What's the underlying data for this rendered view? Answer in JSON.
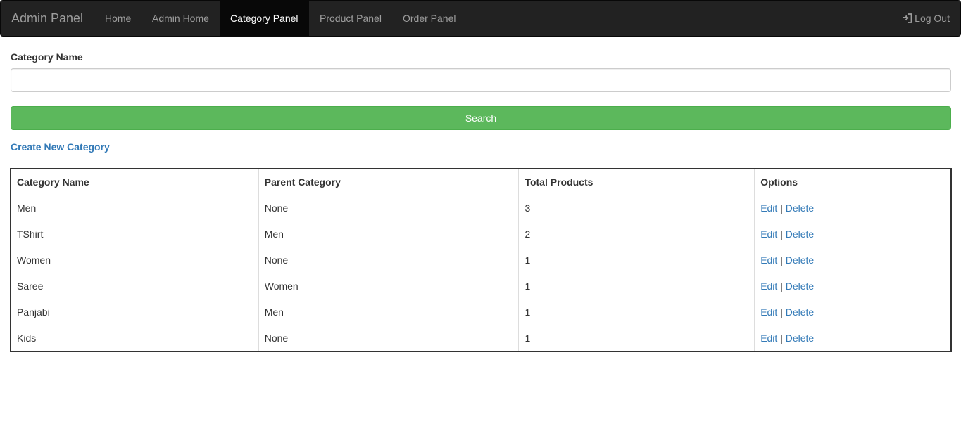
{
  "navbar": {
    "brand": "Admin Panel",
    "items": [
      {
        "label": "Home"
      },
      {
        "label": "Admin Home"
      },
      {
        "label": "Category Panel"
      },
      {
        "label": "Product Panel"
      },
      {
        "label": "Order Panel"
      }
    ],
    "logout": "Log Out"
  },
  "form": {
    "label": "Category Name",
    "value": "",
    "button": "Search"
  },
  "create_link": "Create New Category",
  "table": {
    "headers": [
      "Category Name",
      "Parent Category",
      "Total Products",
      "Options"
    ],
    "rows": [
      {
        "name": "Men",
        "parent": "None",
        "total": "3",
        "edit": "Edit",
        "sep": "|",
        "delete": "Delete"
      },
      {
        "name": "TShirt",
        "parent": "Men",
        "total": "2",
        "edit": "Edit",
        "sep": "|",
        "delete": "Delete"
      },
      {
        "name": "Women",
        "parent": "None",
        "total": "1",
        "edit": "Edit",
        "sep": "|",
        "delete": "Delete"
      },
      {
        "name": "Saree",
        "parent": "Women",
        "total": "1",
        "edit": "Edit",
        "sep": "|",
        "delete": "Delete"
      },
      {
        "name": "Panjabi",
        "parent": "Men",
        "total": "1",
        "edit": "Edit",
        "sep": "|",
        "delete": "Delete"
      },
      {
        "name": "Kids",
        "parent": "None",
        "total": "1",
        "edit": "Edit",
        "sep": "|",
        "delete": "Delete"
      }
    ]
  },
  "colors": {
    "navbar": "#222222",
    "active_nav": "#080808",
    "search_button": "#5cb85c",
    "link": "#337ab7"
  }
}
